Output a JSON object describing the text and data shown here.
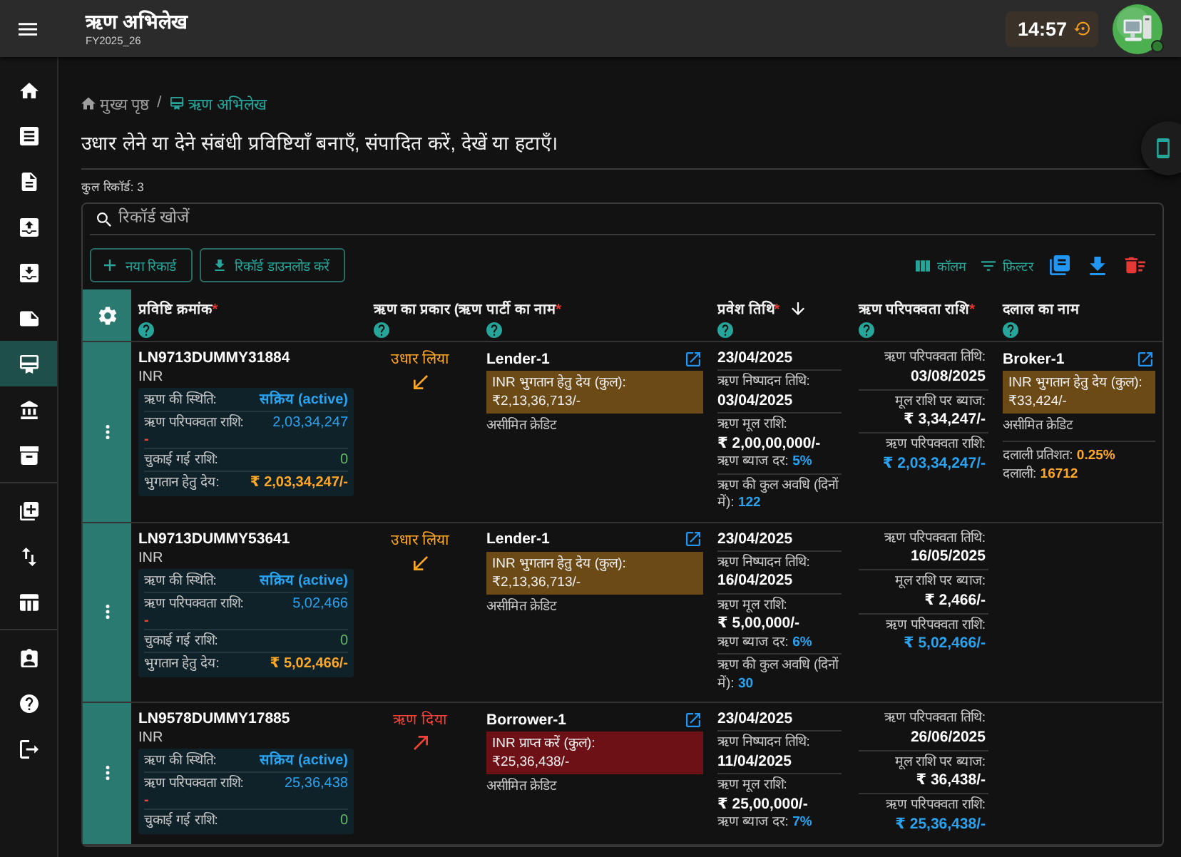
{
  "app_bar": {
    "title": "ऋण अभिलेख",
    "subtitle": "FY2025_26",
    "clock": "14:57"
  },
  "sidebar": {
    "sections": [
      {
        "items": [
          {
            "selected": false
          },
          {
            "selected": false
          },
          {
            "selected": false
          },
          {
            "selected": false
          },
          {
            "selected": false
          },
          {
            "selected": false
          },
          {
            "selected": true
          },
          {
            "selected": false
          },
          {
            "selected": false
          }
        ]
      },
      {
        "items": [
          {
            "selected": false
          },
          {
            "selected": false
          },
          {
            "selected": false
          }
        ]
      },
      {
        "items": [
          {
            "selected": false
          },
          {
            "selected": false
          },
          {
            "selected": false
          }
        ]
      }
    ]
  },
  "breadcrumb": {
    "separator": "/",
    "items": [
      {
        "label": "मुख्य पृष्ठ",
        "current": false
      },
      {
        "label": "ऋण अभिलेख",
        "current": true
      }
    ]
  },
  "description": "उधार लेने या देने संबंधी प्रविष्टियाँ बनाएँ, संपादित करें, देखें या हटाएँ।",
  "record_count": "कुल रिकॉर्ड: 3",
  "toolbar": {
    "search": {
      "placeholder": "रिकॉर्ड खोजें"
    },
    "buttons": [
      {
        "kind": "add",
        "label": "नया रिकार्ड"
      },
      {
        "kind": "download",
        "label": "रिकॉर्ड डाउनलोड करें"
      }
    ],
    "tools": [
      {
        "kind": "columns",
        "label": "कॉलम"
      },
      {
        "kind": "filter",
        "label": "फ़िल्टर"
      }
    ]
  },
  "table": {
    "columns": [
      {
        "label": "प्रविष्टि क्रमांक",
        "required_mark": "*",
        "sorted": false
      },
      {
        "label": "ऋण का प्रकार (ऋण",
        "sorted": false
      },
      {
        "label": "पार्टी का नाम",
        "required_mark": "*",
        "sorted": false
      },
      {
        "label": "प्रवेश तिथि",
        "required_mark": "*",
        "sorted": true
      },
      {
        "label": "ऋण परिपक्वता राशि",
        "required_mark": "*",
        "sorted": false
      },
      {
        "label": "दलाल का नाम",
        "sorted": false
      }
    ],
    "rows": [
      {
        "entry_id": "LN9713DUMMY31884",
        "currency": "INR",
        "summary": [
          {
            "kind": "status",
            "label": "ऋण की स्थिति:",
            "value": "सक्रिय (active)"
          },
          {
            "kind": "maturity",
            "label": "ऋण परिपक्वता राशि:",
            "value": "2,03,34,247",
            "note": "-"
          },
          {
            "kind": "paid",
            "label": "चुकाई गई राशि:",
            "value": "0"
          },
          {
            "kind": "due",
            "label": "भुगतान हेतु देय:",
            "value": "₹ 2,03,34,247/-"
          }
        ],
        "loan_type": {
          "kind": "borrowed",
          "label": "उधार लिया"
        },
        "party": {
          "name": "Lender-1",
          "kind": "payable",
          "balance_label": "INR भुगतान हेतु देय (कुल):",
          "balance": "₹2,13,36,713/-",
          "credit": "असीमित क्रेडिट"
        },
        "entry_date": "23/04/2025",
        "loan_details": [
          [
            {
              "kind": "stacked",
              "label": "ऋण निष्पादन तिथि:",
              "value": "03/04/2025"
            }
          ],
          [
            {
              "kind": "stacked",
              "label": "ऋण मूल राशि:",
              "value": "₹ 2,00,00,000/-"
            },
            {
              "kind": "inline",
              "label": "ऋण ब्याज दर:",
              "value": "5%"
            }
          ],
          [
            {
              "kind": "inline",
              "label": "ऋण की कुल अवधि (दिनों में):",
              "value": "122"
            }
          ]
        ],
        "maturity": [
          {
            "kind": "plain",
            "label": "ऋण परिपक्वता तिथि:",
            "value": "03/08/2025"
          },
          {
            "kind": "plain",
            "label": "मूल राशि पर ब्याज:",
            "value": "₹ 3,34,247/-"
          },
          {
            "kind": "highlight",
            "label": "ऋण परिपक्वता राशि:",
            "value": "₹ 2,03,34,247/-"
          }
        ],
        "broker": {
          "name": "Broker-1",
          "kind": "payable",
          "balance_label": "INR भुगतान हेतु देय (कुल):",
          "balance": "₹33,424/-",
          "credit": "असीमित क्रेडिट",
          "commission": [
            {
              "label": "दलाली प्रतिशत:",
              "value": "0.25%"
            },
            {
              "label": "दलाली:",
              "value": "16712"
            }
          ]
        }
      },
      {
        "entry_id": "LN9713DUMMY53641",
        "currency": "INR",
        "summary": [
          {
            "kind": "status",
            "label": "ऋण की स्थिति:",
            "value": "सक्रिय (active)"
          },
          {
            "kind": "maturity",
            "label": "ऋण परिपक्वता राशि:",
            "value": "5,02,466",
            "note": "-"
          },
          {
            "kind": "paid",
            "label": "चुकाई गई राशि:",
            "value": "0"
          },
          {
            "kind": "due",
            "label": "भुगतान हेतु देय:",
            "value": "₹ 5,02,466/-"
          }
        ],
        "loan_type": {
          "kind": "borrowed",
          "label": "उधार लिया"
        },
        "party": {
          "name": "Lender-1",
          "kind": "payable",
          "balance_label": "INR भुगतान हेतु देय (कुल):",
          "balance": "₹2,13,36,713/-",
          "credit": "असीमित क्रेडिट"
        },
        "entry_date": "23/04/2025",
        "loan_details": [
          [
            {
              "kind": "stacked",
              "label": "ऋण निष्पादन तिथि:",
              "value": "16/04/2025"
            }
          ],
          [
            {
              "kind": "stacked",
              "label": "ऋण मूल राशि:",
              "value": "₹ 5,00,000/-"
            },
            {
              "kind": "inline",
              "label": "ऋण ब्याज दर:",
              "value": "6%"
            }
          ],
          [
            {
              "kind": "inline",
              "label": "ऋण की कुल अवधि (दिनों में):",
              "value": "30"
            }
          ]
        ],
        "maturity": [
          {
            "kind": "plain",
            "label": "ऋण परिपक्वता तिथि:",
            "value": "16/05/2025"
          },
          {
            "kind": "plain",
            "label": "मूल राशि पर ब्याज:",
            "value": "₹ 2,466/-"
          },
          {
            "kind": "highlight",
            "label": "ऋण परिपक्वता राशि:",
            "value": "₹ 5,02,466/-"
          }
        ]
      },
      {
        "entry_id": "LN9578DUMMY17885",
        "currency": "INR",
        "summary": [
          {
            "kind": "status",
            "label": "ऋण की स्थिति:",
            "value": "सक्रिय (active)"
          },
          {
            "kind": "maturity",
            "label": "ऋण परिपक्वता राशि:",
            "value": "25,36,438",
            "note": "-"
          },
          {
            "kind": "paid",
            "label": "चुकाई गई राशि:",
            "value": "0"
          }
        ],
        "loan_type": {
          "kind": "lent",
          "label": "ऋण दिया"
        },
        "party": {
          "name": "Borrower-1",
          "kind": "receivable",
          "balance_label": "INR प्राप्त करें (कुल):",
          "balance": "₹25,36,438/-",
          "credit": "असीमित क्रेडिट"
        },
        "entry_date": "23/04/2025",
        "loan_details": [
          [
            {
              "kind": "stacked",
              "label": "ऋण निष्पादन तिथि:",
              "value": "11/04/2025"
            }
          ],
          [
            {
              "kind": "stacked",
              "label": "ऋण मूल राशि:",
              "value": "₹ 25,00,000/-"
            },
            {
              "kind": "inline",
              "label": "ऋण ब्याज दर:",
              "value": "7%"
            }
          ]
        ],
        "maturity": [
          {
            "kind": "plain",
            "label": "ऋण परिपक्वता तिथि:",
            "value": "26/06/2025"
          },
          {
            "kind": "plain",
            "label": "मूल राशि पर ब्याज:",
            "value": "₹ 36,438/-"
          },
          {
            "kind": "highlight",
            "label": "ऋण परिपक्वता राशि:",
            "value": "₹ 25,36,438/-"
          }
        ]
      }
    ]
  }
}
